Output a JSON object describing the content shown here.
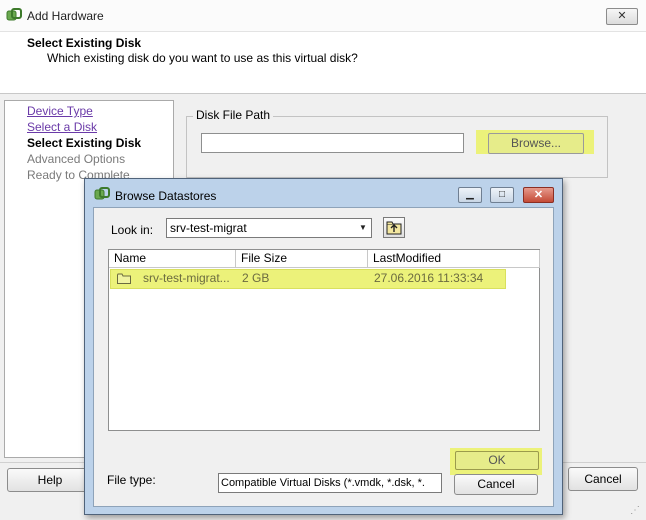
{
  "main_window": {
    "title": "Add Hardware",
    "close_label": "✕",
    "header_title": "Select Existing Disk",
    "header_subtitle": "Which existing disk do you want to use as this virtual disk?",
    "steps": [
      {
        "label": "Device Type",
        "state": "link"
      },
      {
        "label": "Select a Disk",
        "state": "link"
      },
      {
        "label": "Select Existing Disk",
        "state": "current"
      },
      {
        "label": "Advanced Options",
        "state": "disabled"
      },
      {
        "label": "Ready to Complete",
        "state": "disabled"
      }
    ],
    "disk_file_path": {
      "legend": "Disk File Path",
      "value": "",
      "browse_label": "Browse..."
    },
    "help_label": "Help",
    "cancel_label": "Cancel"
  },
  "dialog": {
    "title": "Browse Datastores",
    "look_in_label": "Look in:",
    "look_in_value": "srv-test-migrat",
    "columns": [
      "Name",
      "File Size",
      "LastModified"
    ],
    "rows": [
      {
        "name": "srv-test-migrat...",
        "size": "2 GB",
        "modified": "27.06.2016 11:33:34",
        "selected": true
      }
    ],
    "file_type_label": "File type:",
    "file_type_value": "Compatible Virtual Disks (*.vmdk, *.dsk, *.",
    "ok_label": "OK",
    "cancel_label": "Cancel"
  },
  "colors": {
    "highlight": "#ecf27a",
    "link": "#6a3aa8",
    "dialog_frame": "#bcd2ea"
  }
}
